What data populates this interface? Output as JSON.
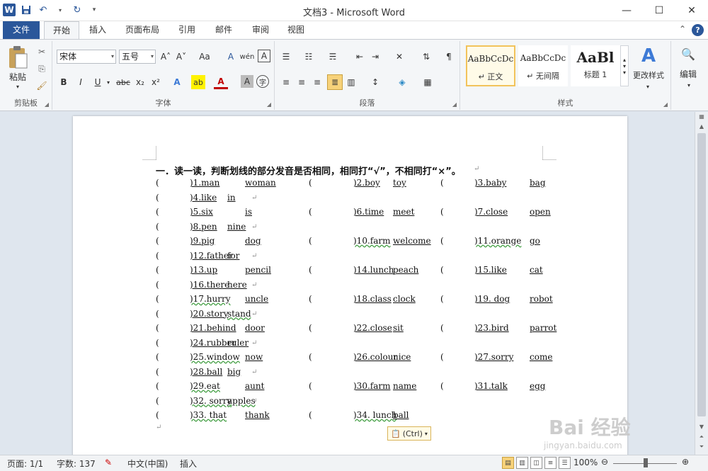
{
  "titlebar": {
    "title": "文档3 - Microsoft Word",
    "logo": "W",
    "save_icon": "save-icon",
    "undo": "↶",
    "redo": "↻",
    "minimize": "—",
    "maximize": "☐",
    "close": "✕"
  },
  "tabs": [
    {
      "label": "文件"
    },
    {
      "label": "开始"
    },
    {
      "label": "插入"
    },
    {
      "label": "页面布局"
    },
    {
      "label": "引用"
    },
    {
      "label": "邮件"
    },
    {
      "label": "审阅"
    },
    {
      "label": "视图"
    }
  ],
  "tabs_right": {
    "collapse": "⌃",
    "help": "?"
  },
  "ribbon": {
    "clipboard": {
      "label": "剪贴板",
      "paste": "粘贴"
    },
    "font": {
      "label": "字体",
      "font_name": "宋体",
      "font_size": "五号",
      "bold": "B",
      "italic": "I",
      "underline": "U",
      "strike": "abc",
      "sub": "x₂",
      "sup": "x²",
      "grow": "A˄",
      "shrink": "A˅",
      "case": "Aa",
      "clear": "A",
      "phonetic": "wén",
      "border": "A",
      "highlight": "ab",
      "fontcolor": "A",
      "shade": "A",
      "enclose": "字"
    },
    "paragraph": {
      "label": "段落"
    },
    "styles": {
      "label": "样式",
      "tiles": [
        {
          "sample": "AaBbCcDc",
          "name": "↵ 正文"
        },
        {
          "sample": "AaBbCcDc",
          "name": "↵ 无间隔"
        },
        {
          "sample": "AaBl",
          "name": "标题 1"
        }
      ],
      "change": "更改样式"
    },
    "editing": {
      "label": "编辑"
    }
  },
  "document": {
    "heading": "一．读一读，判断划线的部分发音是否相同，相同打“√”，不相同打“×”。",
    "lines": [
      [
        "(",
        ")1.man",
        "woman",
        "(",
        ")2.boy",
        "toy",
        "(",
        ")3.baby",
        "bag"
      ],
      [
        "(",
        ")4.like",
        "in"
      ],
      [
        "(",
        ")5.six",
        "is",
        "(",
        ")6.time",
        "meet",
        "(",
        ")7.close",
        "open"
      ],
      [
        "(",
        ")8.pen",
        "nine"
      ],
      [
        "(",
        ")9.pig",
        "dog",
        "(",
        ")10.farm",
        "welcome",
        "(",
        ")11.orange",
        "go"
      ],
      [
        "(",
        ")12.father",
        "for"
      ],
      [
        "(",
        ")13.up",
        "pencil",
        "(",
        ")14.lunch",
        "peach",
        "(",
        ")15.like",
        "cat"
      ],
      [
        "(",
        ")16.there",
        "here"
      ],
      [
        "(",
        ")17.hurry",
        "uncle",
        "(",
        ")18.class",
        "clock",
        "(",
        ")19. dog",
        "robot"
      ],
      [
        "(",
        ")20.story",
        "stand"
      ],
      [
        "(",
        ")21.behind",
        "door",
        "(",
        ")22.close",
        "sit",
        "(",
        ")23.bird",
        "parrot"
      ],
      [
        "(",
        ")24.rubber",
        "ruler"
      ],
      [
        "(",
        ")25.window",
        "now",
        "(",
        ")26.colour",
        "nice",
        "(",
        ")27.sorry",
        "come"
      ],
      [
        "(",
        ")28.ball",
        "big"
      ],
      [
        "(",
        ")29.eat",
        "aunt",
        "(",
        ")30.farm",
        "name",
        "(",
        ")31.talk",
        "egg"
      ],
      [
        "(",
        ")32. sorry",
        "apples"
      ],
      [
        "(",
        ")33. that",
        "thank",
        "(",
        ")34. lunch",
        "ball"
      ]
    ],
    "paste_options": "(Ctrl)"
  },
  "statusbar": {
    "page": "页面: 1/1",
    "words": "字数: 137",
    "language": "中文(中国)",
    "mode": "插入",
    "zoom": "100%"
  },
  "watermark": {
    "main": "Bai 经验",
    "url": "jingyan.baidu.com"
  }
}
